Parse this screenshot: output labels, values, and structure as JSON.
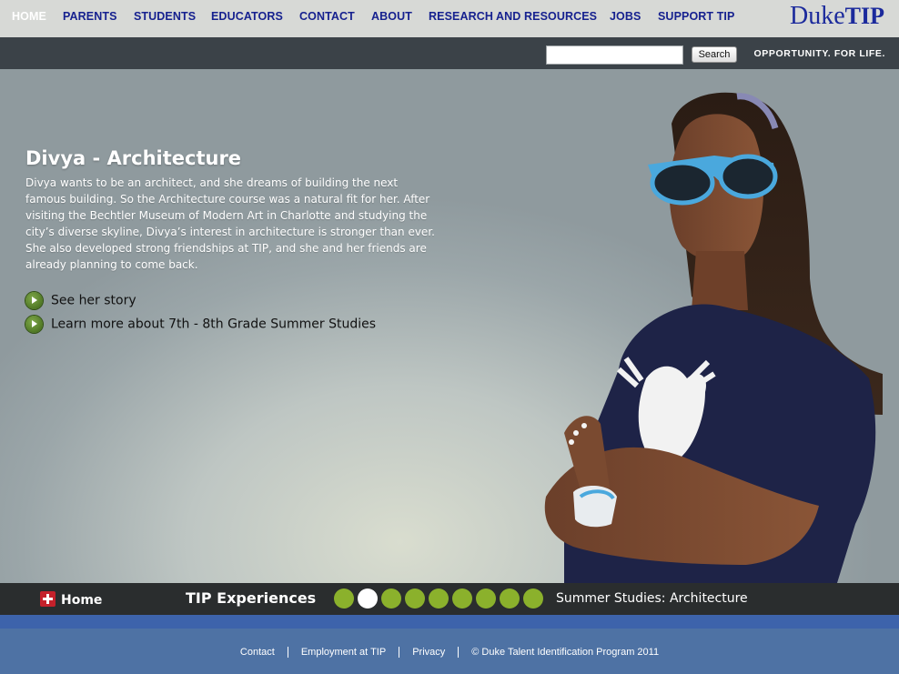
{
  "nav": {
    "items": [
      {
        "label": "HOME",
        "active": true
      },
      {
        "label": "PARENTS"
      },
      {
        "label": "STUDENTS"
      },
      {
        "label": "EDUCATORS"
      },
      {
        "label": "CONTACT"
      },
      {
        "label": "ABOUT"
      },
      {
        "label": "RESEARCH AND RESOURCES"
      },
      {
        "label": "JOBS"
      },
      {
        "label": "SUPPORT TIP"
      }
    ],
    "logo": {
      "duke": "Duke",
      "tip": "TIP"
    }
  },
  "search": {
    "value": "",
    "button_label": "Search",
    "tagline": "OPPORTUNITY. FOR LIFE."
  },
  "hero": {
    "title": "Divya - Architecture",
    "body": "Divya wants to be an architect, and she dreams of building the next famous building. So the Architecture course was a natural fit for her. After visiting the Bechtler Museum of Modern Art in Charlotte and studying the city’s diverse skyline, Divya’s interest in architecture is stronger than ever. She also developed strong friendships at TIP, and she and her friends are already planning to come back.",
    "links": [
      {
        "label": "See her story",
        "icon": "play-arrow-icon"
      },
      {
        "label": "Learn more about 7th - 8th Grade Summer Studies",
        "icon": "play-arrow-icon"
      }
    ]
  },
  "experiences": {
    "home_label": "Home",
    "title": "TIP Experiences",
    "dot_count": 9,
    "active_dot": 2,
    "caption": "Summer Studies: Architecture",
    "dot_color": "#8bb12c"
  },
  "footer": {
    "links": [
      "Contact",
      "Employment at TIP",
      "Privacy",
      "© Duke Talent Identification Program 2011"
    ]
  },
  "colors": {
    "nav_text": "#16218f",
    "logo": "#1b2a9c",
    "footer_bg": "#4e72a4",
    "accent_strip": "#3d63ab"
  }
}
